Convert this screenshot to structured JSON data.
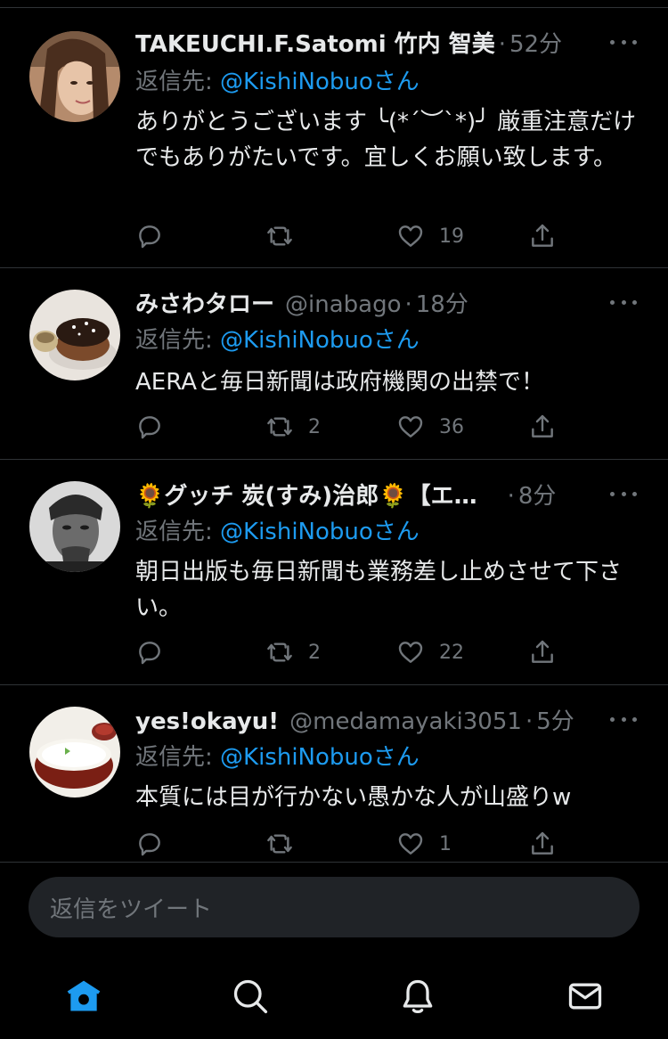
{
  "colors": {
    "background": "#000000",
    "accent": "#1d9bf0",
    "muted": "#71767b",
    "text": "#e7e9ea"
  },
  "tweets": [
    {
      "name": "TAKEUCHI.F.Satomi 竹内 智美",
      "handle": "",
      "dot": "·",
      "time": "52分",
      "reply_prefix": "返信先:",
      "reply_to": "@KishiNobuoさん",
      "text": "ありがとうございます ╰(*´︶`*)╯ 厳重注意だけでもありがたいです。宜しくお願い致します。",
      "replies": "",
      "retweets": "",
      "likes": "19"
    },
    {
      "name": "みさわタロー",
      "handle": "@inabago",
      "dot": "·",
      "time": "18分",
      "reply_prefix": "返信先:",
      "reply_to": "@KishiNobuoさん",
      "text": "AERAと毎日新聞は政府機関の出禁で！",
      "replies": "",
      "retweets": "2",
      "likes": "36"
    },
    {
      "name": "🌻グッチ 炭(すみ)治郎🌻【エ…",
      "handle": "",
      "dot": "·",
      "time": "8分",
      "reply_prefix": "返信先:",
      "reply_to": "@KishiNobuoさん",
      "text": "朝日出版も毎日新聞も業務差し止めさせて下さい。",
      "replies": "",
      "retweets": "2",
      "likes": "22"
    },
    {
      "name": "yes!okayu!",
      "handle": "@medamayaki3051",
      "dot": "·",
      "time": "5分",
      "reply_prefix": "返信先:",
      "reply_to": "@KishiNobuoさん",
      "text": "本質には目が行かない愚かな人が山盛りw",
      "replies": "",
      "retweets": "",
      "likes": "1"
    }
  ],
  "composer": {
    "placeholder": "返信をツイート"
  },
  "tabbar": {
    "items": [
      "home-icon",
      "search-icon",
      "bell-icon",
      "mail-icon"
    ]
  }
}
